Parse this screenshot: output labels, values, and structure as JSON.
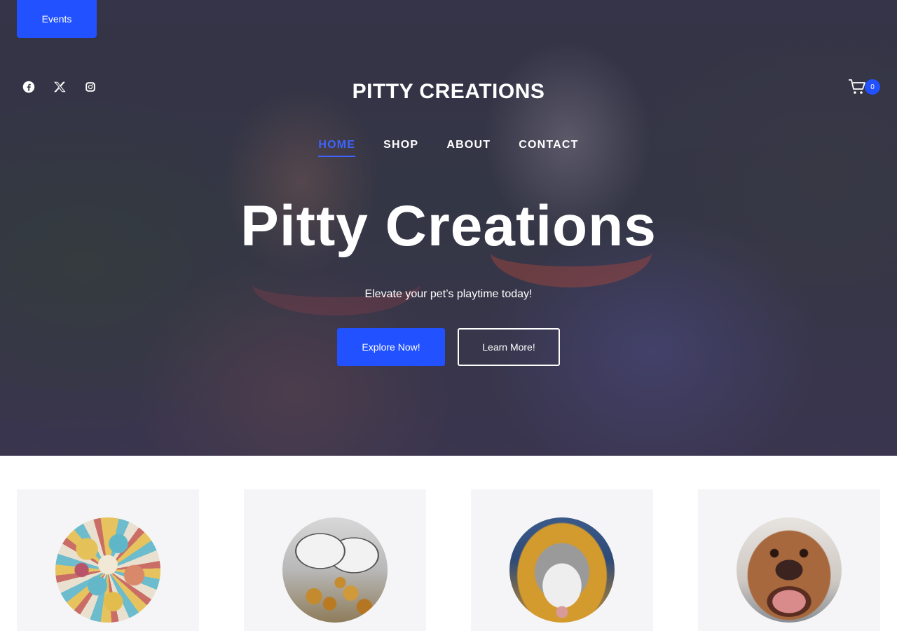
{
  "top_bar": {
    "events_label": "Events"
  },
  "social": [
    {
      "name": "facebook-icon"
    },
    {
      "name": "x-icon"
    },
    {
      "name": "instagram-icon"
    }
  ],
  "header": {
    "site_title": "PITTY CREATIONS",
    "cart_count": "0"
  },
  "nav": [
    {
      "label": "HOME",
      "active": true
    },
    {
      "label": "SHOP",
      "active": false
    },
    {
      "label": "ABOUT",
      "active": false
    },
    {
      "label": "CONTACT",
      "active": false
    }
  ],
  "hero": {
    "heading": "Pitty Creations",
    "subheading": "Elevate your pet’s playtime today!",
    "primary_button": "Explore Now!",
    "secondary_button": "Learn More!"
  },
  "colors": {
    "accent": "#2251ff",
    "card_background": "#f5f5f7"
  }
}
